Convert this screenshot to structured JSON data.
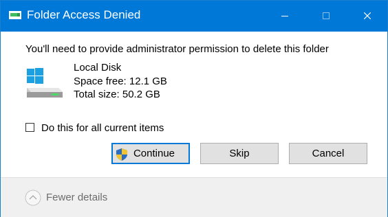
{
  "window": {
    "title": "Folder Access Denied",
    "controls": [
      "minimize",
      "maximize",
      "close"
    ],
    "accent": "#0078d7"
  },
  "content": {
    "message": "You'll need to provide administrator permission to delete this folder",
    "drive": {
      "icon": "local-disk-icon",
      "name": "Local Disk",
      "space_free": "Space free: 12.1 GB",
      "total_size": "Total size: 50.2 GB"
    },
    "checkbox": {
      "label": "Do this for all current items",
      "checked": false
    }
  },
  "buttons": {
    "continue": "Continue",
    "skip": "Skip",
    "cancel": "Cancel"
  },
  "footer": {
    "details_toggle": "Fewer details",
    "icon": "chevron-up-circle-icon"
  }
}
